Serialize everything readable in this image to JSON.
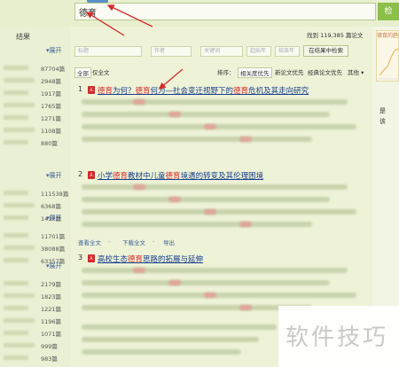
{
  "search": {
    "value": "德育",
    "button_label": "检"
  },
  "sidebar": {
    "header": "结果",
    "expand_label": "展开",
    "groups": [
      {
        "counts": [
          "87704篇",
          "2948篇",
          "1917篇",
          "1765篇",
          "1271篇",
          "1108篇",
          "880篇"
        ]
      },
      {
        "counts": [
          "111538篇",
          "6368篇",
          "1417篇"
        ]
      },
      {
        "counts": [
          "11701篇",
          "38088篇",
          "63357篇"
        ]
      },
      {
        "counts": [
          "2179篇",
          "1823篇",
          "1221篇",
          "1196篇",
          "1071篇",
          "999篇",
          "983篇"
        ]
      }
    ]
  },
  "results_bar": {
    "stats": "找到 119,385 篇论文"
  },
  "filters": {
    "fields": [
      "标题",
      "作者",
      "关键词",
      "起始年",
      "结束年"
    ],
    "button": "在结果中检索"
  },
  "sort": {
    "left": [
      "全部",
      "仅全文"
    ],
    "label": "排序：",
    "options": [
      "相关度优先",
      "新论文优先",
      "经典论文优先",
      "其他"
    ]
  },
  "results": [
    {
      "num": "1",
      "title_parts": [
        {
          "t": "德育",
          "hl": true
        },
        {
          "t": "为何？",
          "hl": false
        },
        {
          "t": "德育",
          "hl": true
        },
        {
          "t": "何为—社会变迁视野下的",
          "hl": false
        },
        {
          "t": "德育",
          "hl": true
        },
        {
          "t": "危机及其走向研究",
          "hl": false
        }
      ]
    },
    {
      "num": "2",
      "title_parts": [
        {
          "t": "小学",
          "hl": false
        },
        {
          "t": "德育",
          "hl": true
        },
        {
          "t": "教材中儿童",
          "hl": false
        },
        {
          "t": "德育",
          "hl": true
        },
        {
          "t": "境遇的转变及其伦理困境",
          "hl": false
        }
      ],
      "actions": [
        "查看全文",
        "下载全文",
        "导出"
      ]
    },
    {
      "num": "3",
      "title_parts": [
        {
          "t": "高校生态",
          "hl": false
        },
        {
          "t": "德育",
          "hl": true
        },
        {
          "t": "思路的拓展与延伸",
          "hl": false
        }
      ]
    }
  ],
  "right_panel": {
    "chart_label": "德育的趋",
    "text1": "是",
    "text2": "该"
  },
  "watermark": "软件技巧"
}
